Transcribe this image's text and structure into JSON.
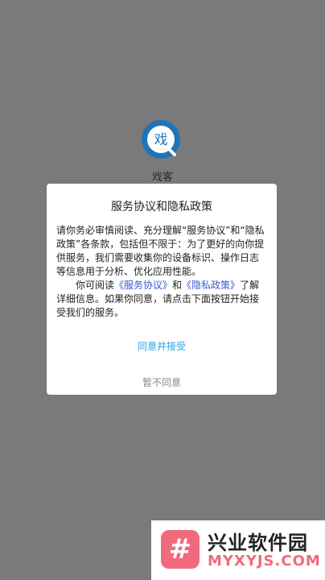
{
  "app": {
    "name": "戏客",
    "logo_char": "戏",
    "accent_color": "#1f74b8",
    "background_color": "#7a7a7a"
  },
  "dialog": {
    "title": "服务协议和隐私政策",
    "paragraph1": "请你务必审慎阅读、充分理解“服务协议”和“隐私政策”各条款，包括但不限于：为了更好的向你提供服务，我们需要收集你的设备标识、操作日志等信息用于分析、优化应用性能。",
    "p2_prefix": "你可阅读",
    "service_link": "《服务协议》",
    "p2_and": "和",
    "privacy_link": "《隐私政策》",
    "p2_suffix": "了解详细信息。如果你同意，请点击下面按钮开始接受我们的服务。",
    "agree_label": "同意并接受",
    "reject_label": "暂不同意",
    "link_color": "#3a59d6",
    "agree_color": "#2aa3e6"
  },
  "watermark": {
    "icon": "hash-icon",
    "title": "兴业软件园",
    "subtitle": "MYXYJS.COM",
    "color": "#f06a7e"
  }
}
